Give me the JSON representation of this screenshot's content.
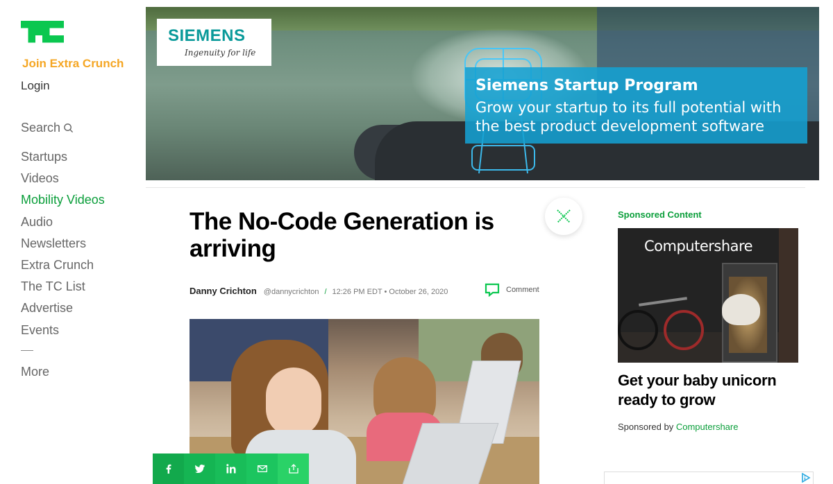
{
  "sidebar": {
    "join_label": "Join Extra Crunch",
    "login_label": "Login",
    "search_label": "Search",
    "nav_items": [
      {
        "label": "Startups"
      },
      {
        "label": "Videos"
      },
      {
        "label": "Mobility Videos",
        "active": true
      },
      {
        "label": "Audio"
      },
      {
        "label": "Newsletters"
      },
      {
        "label": "Extra Crunch"
      },
      {
        "label": "The TC List"
      },
      {
        "label": "Advertise"
      },
      {
        "label": "Events"
      }
    ],
    "more_label": "More"
  },
  "banner_ad": {
    "brand": "SIEMENS",
    "slogan": "Ingenuity for life",
    "title": "Siemens Startup Program",
    "text_line1": "Grow your startup to its full potential with",
    "text_line2": "the best product development software"
  },
  "article": {
    "headline": "The No-Code Generation is arriving",
    "author": "Danny Crichton",
    "handle": "@dannycrichton",
    "separator": "/",
    "timestamp": "12:26 PM EDT • October 26, 2020",
    "comment_label": "Comment"
  },
  "share_bar": {
    "buttons": [
      "facebook-icon",
      "twitter-icon",
      "linkedin-icon",
      "email-icon",
      "share-icon"
    ]
  },
  "sponsored": {
    "label": "Sponsored Content",
    "image_brand": "Computershare",
    "title": "Get your baby unicorn ready to grow",
    "by_prefix": "Sponsored by",
    "by_link": "Computershare"
  },
  "colors": {
    "brand_green": "#0a9e3a",
    "join_orange": "#f5a623",
    "siemens_teal": "#0a9a9a",
    "promo_blue": "#14a0d2"
  }
}
